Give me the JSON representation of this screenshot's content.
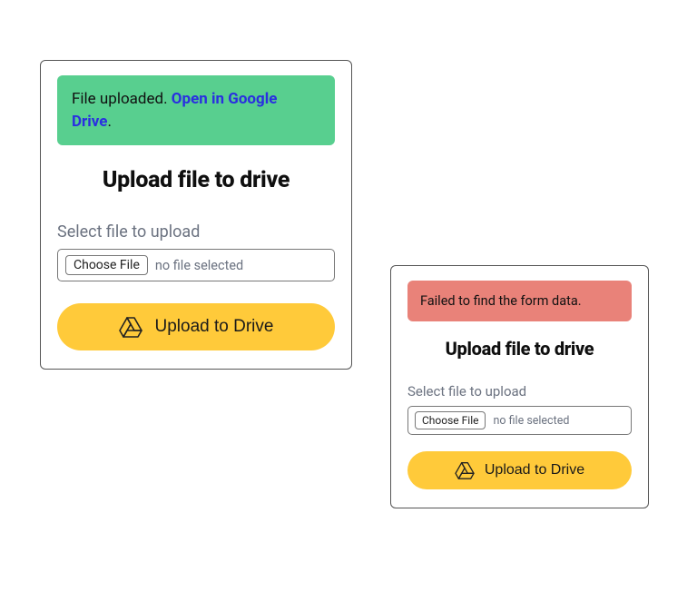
{
  "cards": [
    {
      "banner": {
        "type": "success",
        "prefix": "File uploaded. ",
        "link_text": "Open in Google Drive",
        "suffix": "."
      },
      "heading": "Upload file to drive",
      "field_label": "Select file to upload",
      "choose_button": "Choose File",
      "file_status": "no file selected",
      "upload_button": "Upload to Drive"
    },
    {
      "banner": {
        "type": "error",
        "message": "Failed to find the form data."
      },
      "heading": "Upload file to drive",
      "field_label": "Select file to upload",
      "choose_button": "Choose File",
      "file_status": "no file selected",
      "upload_button": "Upload to Drive"
    }
  ],
  "colors": {
    "success_bg": "#58cf8f",
    "error_bg": "#e98279",
    "accent_button": "#ffca3a",
    "link_color": "#2a2fe0"
  }
}
